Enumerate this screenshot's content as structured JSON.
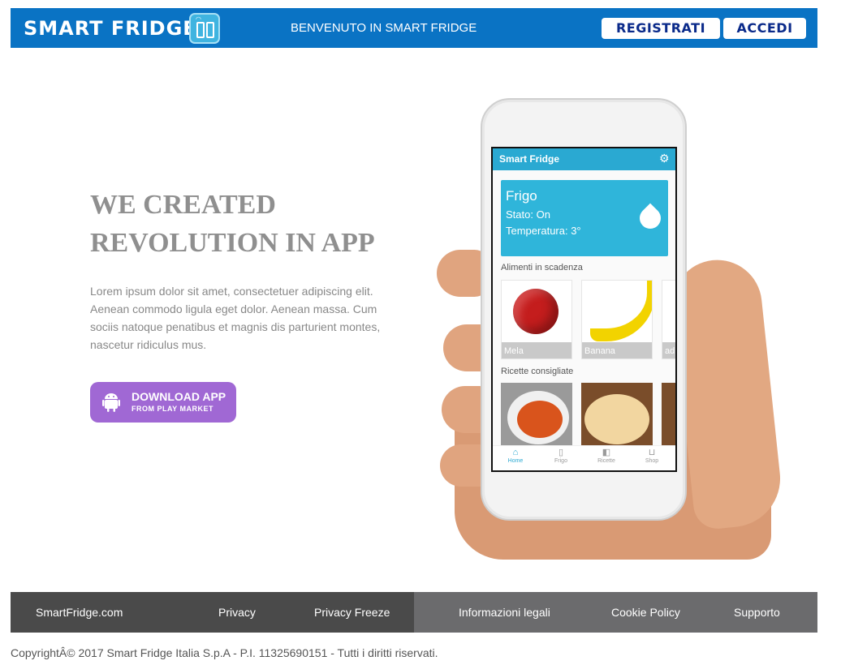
{
  "header": {
    "logo_text": "SMART FRIDGE",
    "welcome": "BENVENUTO IN SMART FRIDGE",
    "register_label": "REGISTRATI",
    "login_label": "ACCEDI"
  },
  "hero": {
    "title_line1": "WE CREATED",
    "title_line2": "REVOLUTION IN APP",
    "body": "Lorem ipsum dolor sit amet, consectetuer adipiscing elit. Aenean commodo ligula eget dolor. Aenean massa. Cum sociis natoque penatibus et magnis dis parturient montes, nascetur ridiculus mus.",
    "download": {
      "line1": "DOWNLOAD APP",
      "line2": "FROM PLAY MARKET",
      "icon": "android-icon"
    }
  },
  "phone_app": {
    "app_title": "Smart Fridge",
    "fridge_card": {
      "title": "Frigo",
      "status": "Stato: On",
      "temperature": "Temperatura: 3°"
    },
    "expiring_label": "Alimenti in scadenza",
    "expiring_items": [
      "Mela",
      "Banana",
      "ad"
    ],
    "recipes_label": "Ricette consigliate",
    "nav": [
      "Home",
      "Frigo",
      "Ricette",
      "Shop"
    ]
  },
  "footer": {
    "links_left": [
      "SmartFridge.com",
      "Privacy",
      "Privacy Freeze"
    ],
    "links_right": [
      "Informazioni legali",
      "Cookie Policy",
      "Supporto"
    ],
    "copyright": "CopyrightÂ© 2017 Smart Fridge Italia S.p.A - P.I. 11325690151 - Tutti i diritti riservati."
  },
  "colors": {
    "header_bg": "#0a73c4",
    "download_bg": "#a068d4",
    "footer_left_bg": "#4a4a4a",
    "footer_right_bg": "#6b6b6d",
    "app_accent": "#2aa9d2"
  }
}
